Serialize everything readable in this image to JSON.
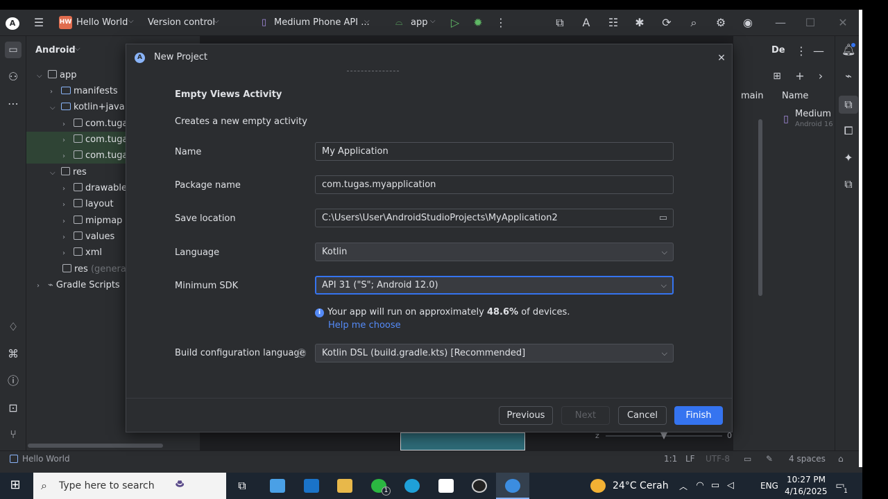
{
  "topbar": {
    "project_badge": "HW",
    "project_name": "Hello World",
    "vcs": "Version control",
    "device": "Medium Phone API ...",
    "run_config": "app"
  },
  "project_panel": {
    "view": "Android",
    "tree": [
      {
        "label": "app"
      },
      {
        "label": "manifests"
      },
      {
        "label": "kotlin+java"
      },
      {
        "label": "com.tuga"
      },
      {
        "label": "com.tuga"
      },
      {
        "label": "com.tuga"
      },
      {
        "label": "res"
      },
      {
        "label": "drawable"
      },
      {
        "label": "layout"
      },
      {
        "label": "mipmap"
      },
      {
        "label": "values"
      },
      {
        "label": "xml"
      },
      {
        "label": "res",
        "suffix": "(generate"
      },
      {
        "label": "Gradle Scripts"
      }
    ]
  },
  "right_panel": {
    "tab": "De",
    "col_main": "main",
    "col_name": "Name",
    "item_name": "Medium P",
    "item_sub": "Android 16"
  },
  "dialog": {
    "title": "New Project",
    "template_title": "Empty Views Activity",
    "template_desc": "Creates a new empty activity",
    "fields": {
      "name_label": "Name",
      "name_value": "My Application",
      "package_label": "Package name",
      "package_value": "com.tugas.myapplication",
      "save_label": "Save location",
      "save_value": "C:\\Users\\User\\AndroidStudioProjects\\MyApplication2",
      "language_label": "Language",
      "language_value": "Kotlin",
      "minsdk_label": "Minimum SDK",
      "minsdk_value": "API 31 (\"S\"; Android 12.0)",
      "build_label": "Build configuration language",
      "build_value": "Kotlin DSL (build.gradle.kts) [Recommended]"
    },
    "info_prefix": "Your app will run on approximately",
    "info_percent": "48.6%",
    "info_suffix": "of devices.",
    "help_link": "Help me choose",
    "buttons": {
      "previous": "Previous",
      "next": "Next",
      "cancel": "Cancel",
      "finish": "Finish"
    }
  },
  "zoom": {
    "left": "z",
    "right": "0"
  },
  "statusbar": {
    "project": "Hello World",
    "position": "1:1",
    "line_sep": "LF",
    "encoding": "UTF-8",
    "indent": "4 spaces"
  },
  "taskbar": {
    "search_placeholder": "Type here to search",
    "weather": "24°C Cerah",
    "lang": "ENG",
    "time": "10:27 PM",
    "date": "4/16/2025",
    "whatsapp_badge": "1",
    "notif_badge": "1"
  },
  "colors": {
    "accent": "#3574f0",
    "link": "#548af7",
    "bg": "#2b2d30"
  }
}
